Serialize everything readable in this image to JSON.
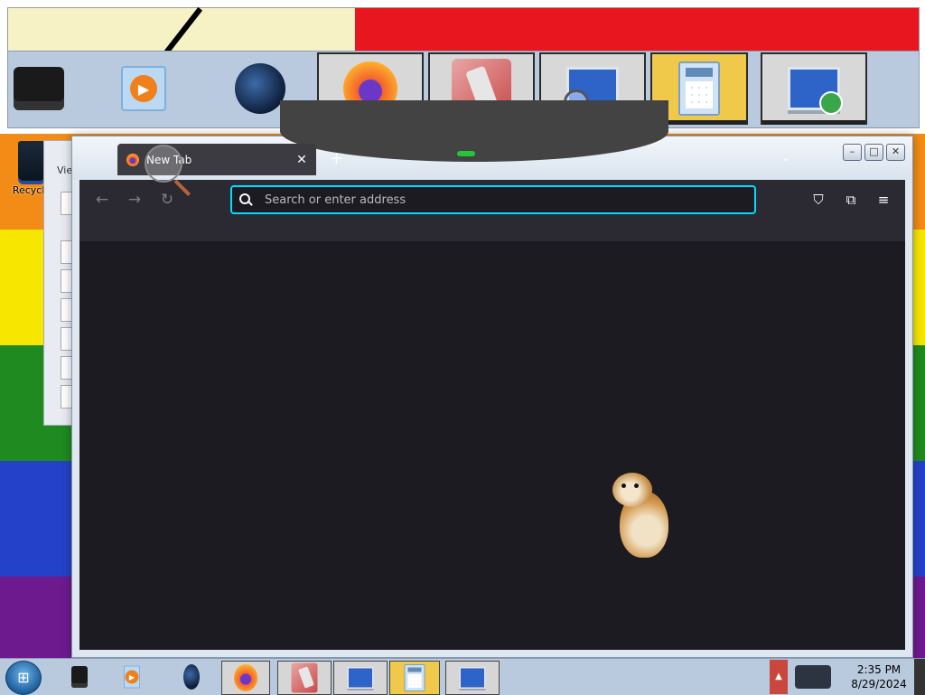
{
  "desktop": {
    "recycle_bin_label": "Recycle",
    "behind_window_label": "Vie"
  },
  "top_dock": {
    "items": [
      {
        "name": "printer",
        "active": false
      },
      {
        "name": "media-player",
        "active": false
      },
      {
        "name": "globe",
        "active": false
      },
      {
        "name": "firefox",
        "active": true
      },
      {
        "name": "disk-cleanup",
        "active": true
      },
      {
        "name": "search-computer",
        "active": true
      },
      {
        "name": "calculator",
        "active": true
      },
      {
        "name": "remote-desktop",
        "active": true
      }
    ]
  },
  "browser": {
    "tab_title": "New Tab",
    "tab_close_glyph": "✕",
    "new_tab_glyph": "+",
    "list_tabs_glyph": "⌄",
    "url_placeholder": "Search or enter address",
    "url_value": "",
    "window_buttons": {
      "minimize": "–",
      "maximize": "□",
      "close": "✕"
    },
    "nav": {
      "back": "←",
      "forward": "→",
      "reload": "↻"
    },
    "toolbar_icons": {
      "pocket": "⛉",
      "extensions": "⧉",
      "menu": "≡"
    }
  },
  "taskbar": {
    "start_glyph": "⊞",
    "tray_up_glyph": "▲",
    "time": "2:35 PM",
    "date": "8/29/2024"
  }
}
